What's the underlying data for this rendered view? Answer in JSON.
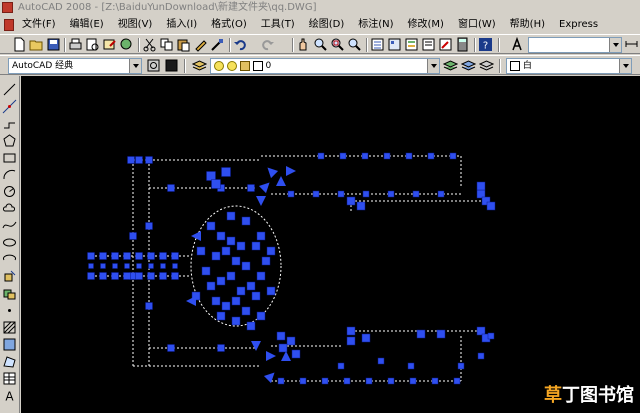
{
  "titlebar": {
    "title": "AutoCAD 2008 - [Z:\\BaiduYunDownload\\新建文件夹\\qq.DWG]"
  },
  "menu": {
    "items": [
      "文件(F)",
      "编辑(E)",
      "视图(V)",
      "插入(I)",
      "格式(O)",
      "工具(T)",
      "绘图(D)",
      "标注(N)",
      "修改(M)",
      "窗口(W)",
      "帮助(H)",
      "Express"
    ]
  },
  "toolbar": {
    "workspace_value": "AutoCAD 经典",
    "layer_value": "0",
    "color_value": "白"
  },
  "colors": {
    "entity_blue": "#2f4ff0",
    "canvas": "#000000",
    "dashed_line": "#ffffff"
  },
  "watermark": {
    "first_char": "草",
    "rest": "丁图书馆"
  }
}
